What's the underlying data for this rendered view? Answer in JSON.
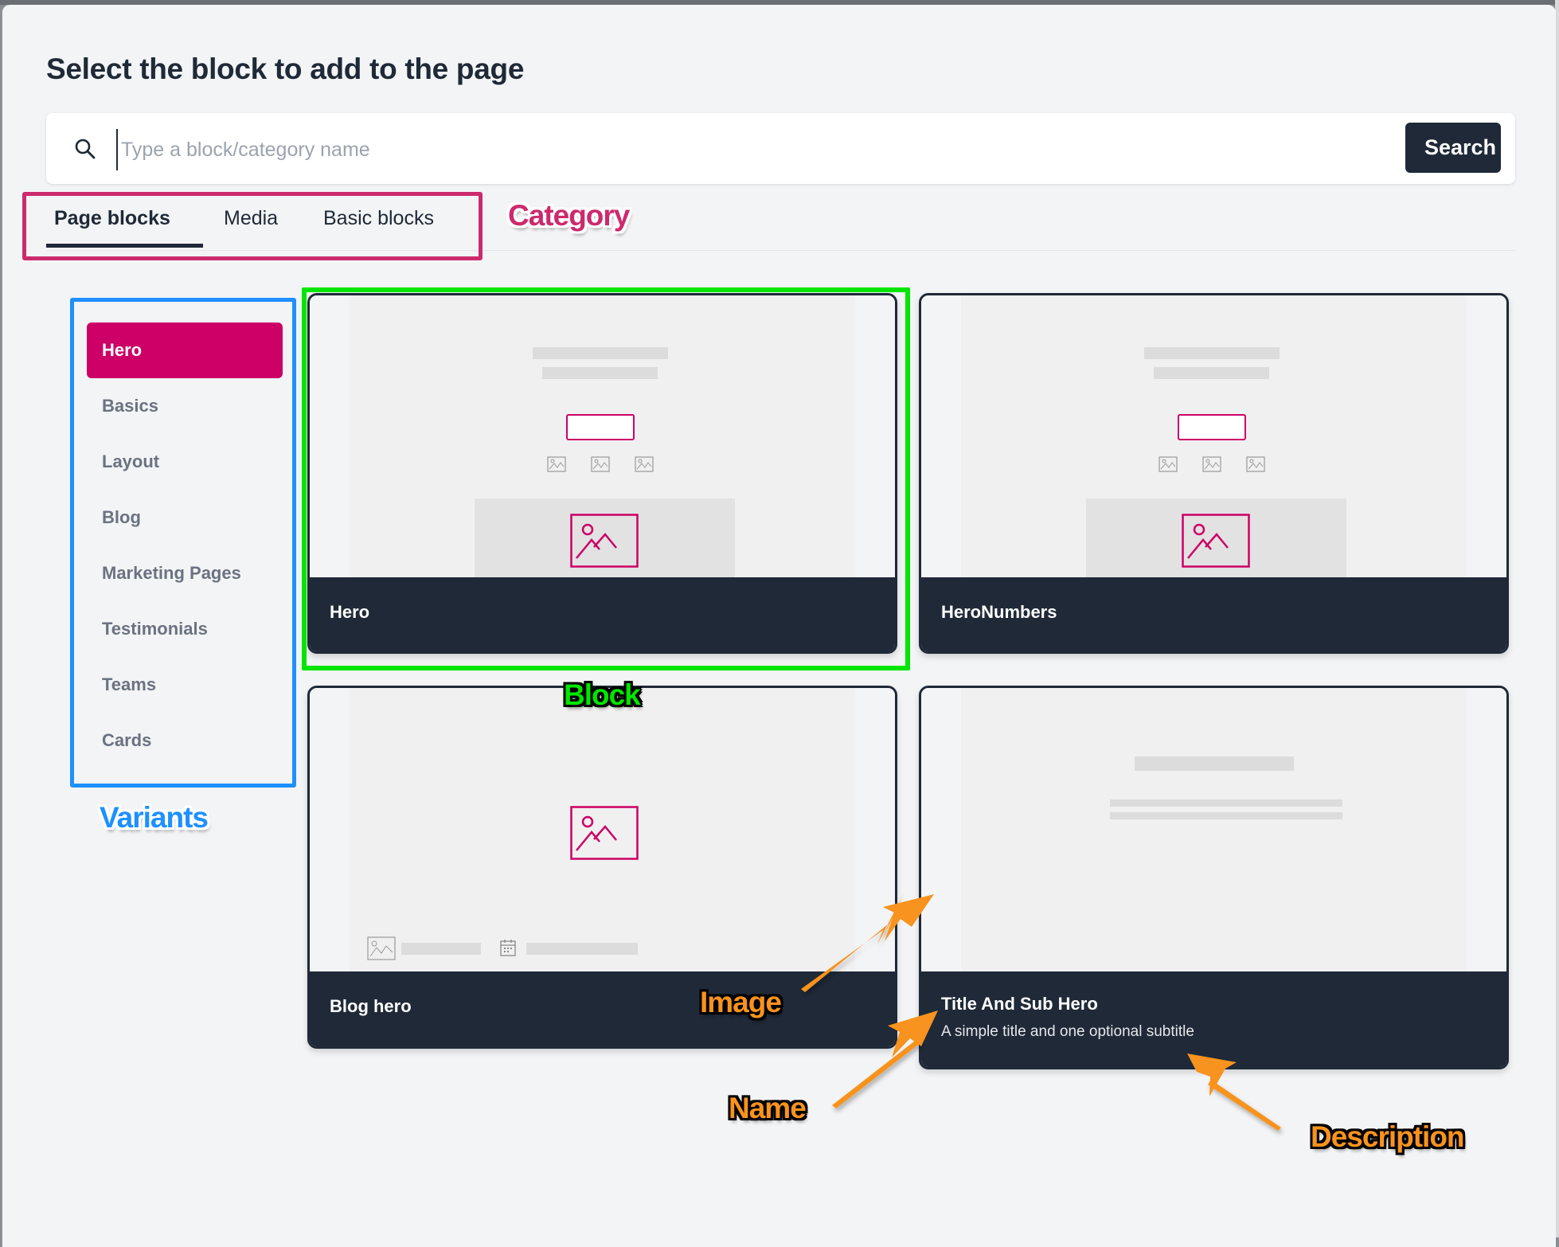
{
  "dialog": {
    "title": "Select the block to add to the page"
  },
  "search": {
    "placeholder": "Type a block/category name",
    "value": "",
    "button_label": "Search",
    "icon": "search-icon"
  },
  "tabs": [
    {
      "label": "Page blocks",
      "active": true
    },
    {
      "label": "Media",
      "active": false
    },
    {
      "label": "Basic blocks",
      "active": false
    }
  ],
  "variants": [
    {
      "label": "Hero",
      "active": true
    },
    {
      "label": "Basics",
      "active": false
    },
    {
      "label": "Layout",
      "active": false
    },
    {
      "label": "Blog",
      "active": false
    },
    {
      "label": "Marketing Pages",
      "active": false
    },
    {
      "label": "Testimonials",
      "active": false
    },
    {
      "label": "Teams",
      "active": false
    },
    {
      "label": "Cards",
      "active": false
    }
  ],
  "blocks": [
    {
      "name": "Hero",
      "description": "",
      "preview": "hero-layout"
    },
    {
      "name": "HeroNumbers",
      "description": "",
      "preview": "hero-layout"
    },
    {
      "name": "Blog hero",
      "description": "",
      "preview": "blog-hero-layout"
    },
    {
      "name": "Title And Sub Hero",
      "description": "A simple title and one optional subtitle",
      "preview": "title-sub-layout"
    }
  ],
  "annotations": {
    "category": {
      "label": "Category",
      "color": "#cc2a6d"
    },
    "variants": {
      "label": "Variants",
      "color": "#1e90ff"
    },
    "block": {
      "label": "Block",
      "color": "#00e600"
    },
    "image": {
      "label": "Image",
      "color": "#f7931e"
    },
    "name": {
      "label": "Name",
      "color": "#f7931e"
    },
    "description": {
      "label": "Description",
      "color": "#f7931e"
    }
  },
  "colors": {
    "accent": "#cc0066",
    "dark": "#1f2937",
    "background": "#f3f4f6",
    "muted_text": "#6b7280"
  }
}
